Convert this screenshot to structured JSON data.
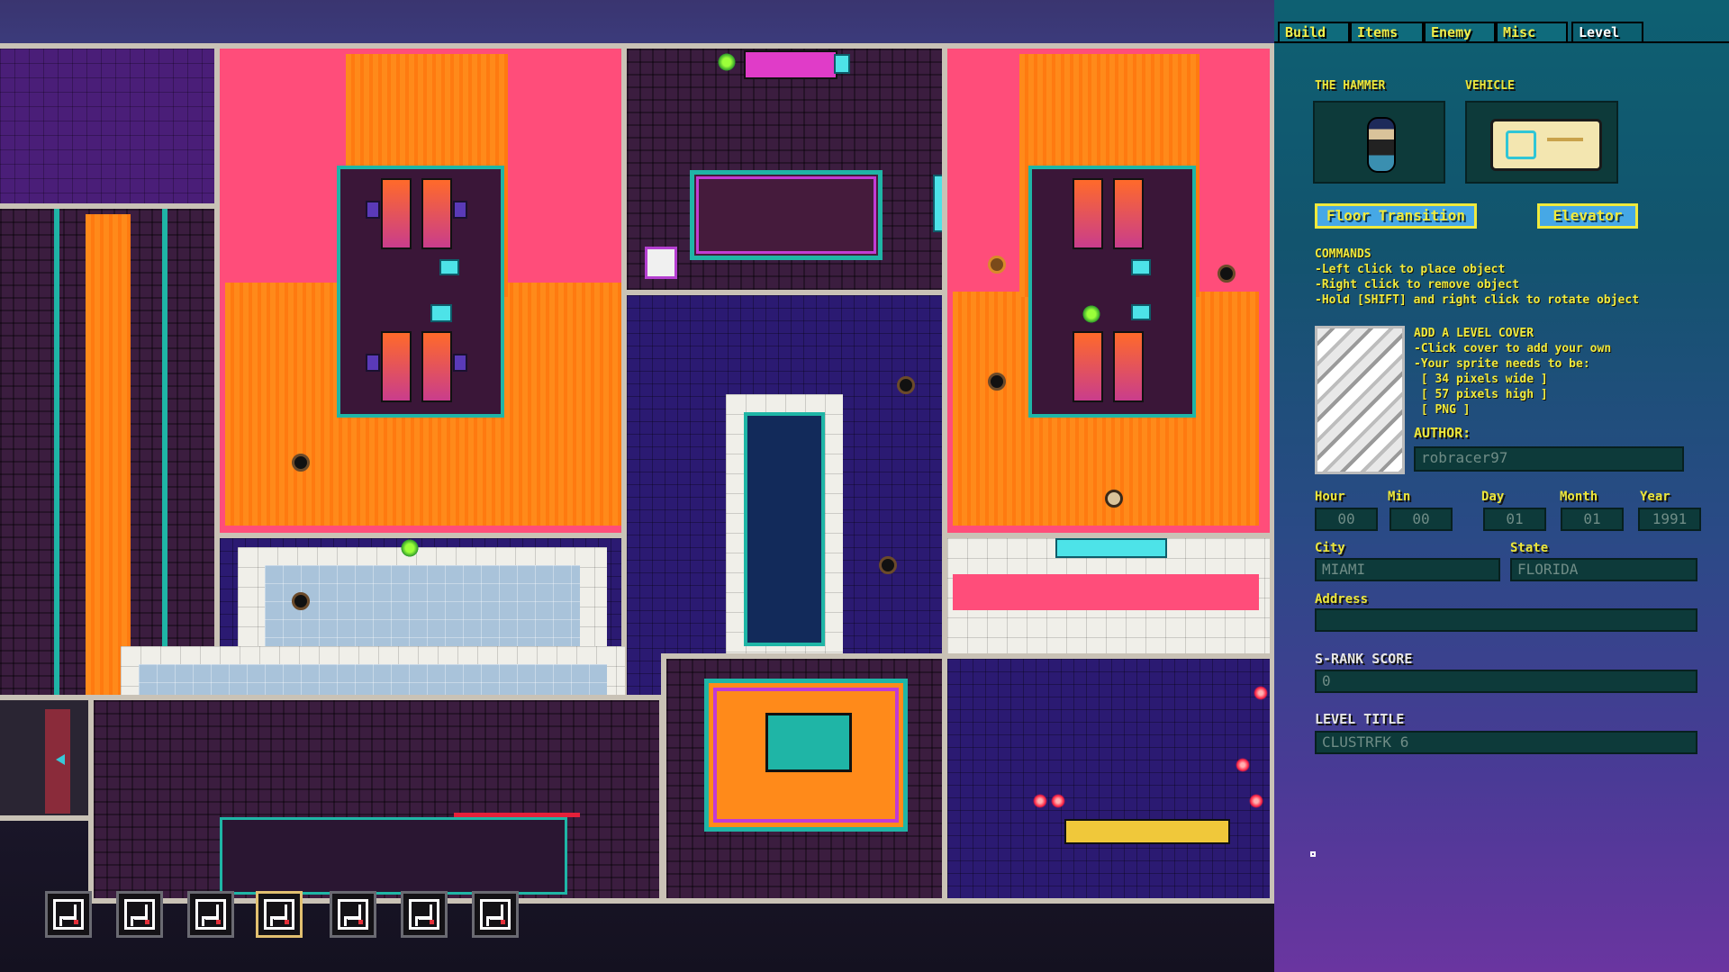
{
  "tabs": [
    "Build",
    "Items",
    "Enemy",
    "Misc",
    "Level"
  ],
  "active_tab": "Level",
  "level": {
    "player_label": "THE HAMMER",
    "vehicle_label": "VEHICLE",
    "floor_transition_label": "Floor Transition",
    "elevator_label": "Elevator",
    "commands_title": "COMMANDS",
    "commands": [
      "-Left click to place object",
      "-Right click to remove object",
      "-Hold [SHIFT] and right click to rotate object"
    ],
    "cover_title": "ADD A LEVEL COVER",
    "cover_lines": [
      "-Click cover to add your own",
      "-Your sprite needs to be:",
      " [ 34 pixels wide ]",
      " [ 57 pixels high ]",
      " [ PNG ]"
    ],
    "author_label": "AUTHOR:",
    "author_value": "robracer97",
    "date": {
      "hour_label": "Hour",
      "hour": "00",
      "min_label": "Min",
      "min": "00",
      "day_label": "Day",
      "day": "01",
      "month_label": "Month",
      "month": "01",
      "year_label": "Year",
      "year": "1991"
    },
    "city_label": "City",
    "city": "MIAMI",
    "state_label": "State",
    "state": "FLORIDA",
    "address_label": "Address",
    "address": "",
    "srank_label": "S-RANK SCORE",
    "srank": "0",
    "title_label": "LEVEL TITLE",
    "title": "CLUSTRFK 6"
  },
  "floor_slots": {
    "count": 7,
    "selected_index": 4
  },
  "colors": {
    "panel_top": "#0e6072",
    "panel_bottom": "#6a35a0",
    "label_yellow": "#ece63a",
    "field_bg": "#0d3a3a",
    "button_blue": "#46a8e6"
  }
}
